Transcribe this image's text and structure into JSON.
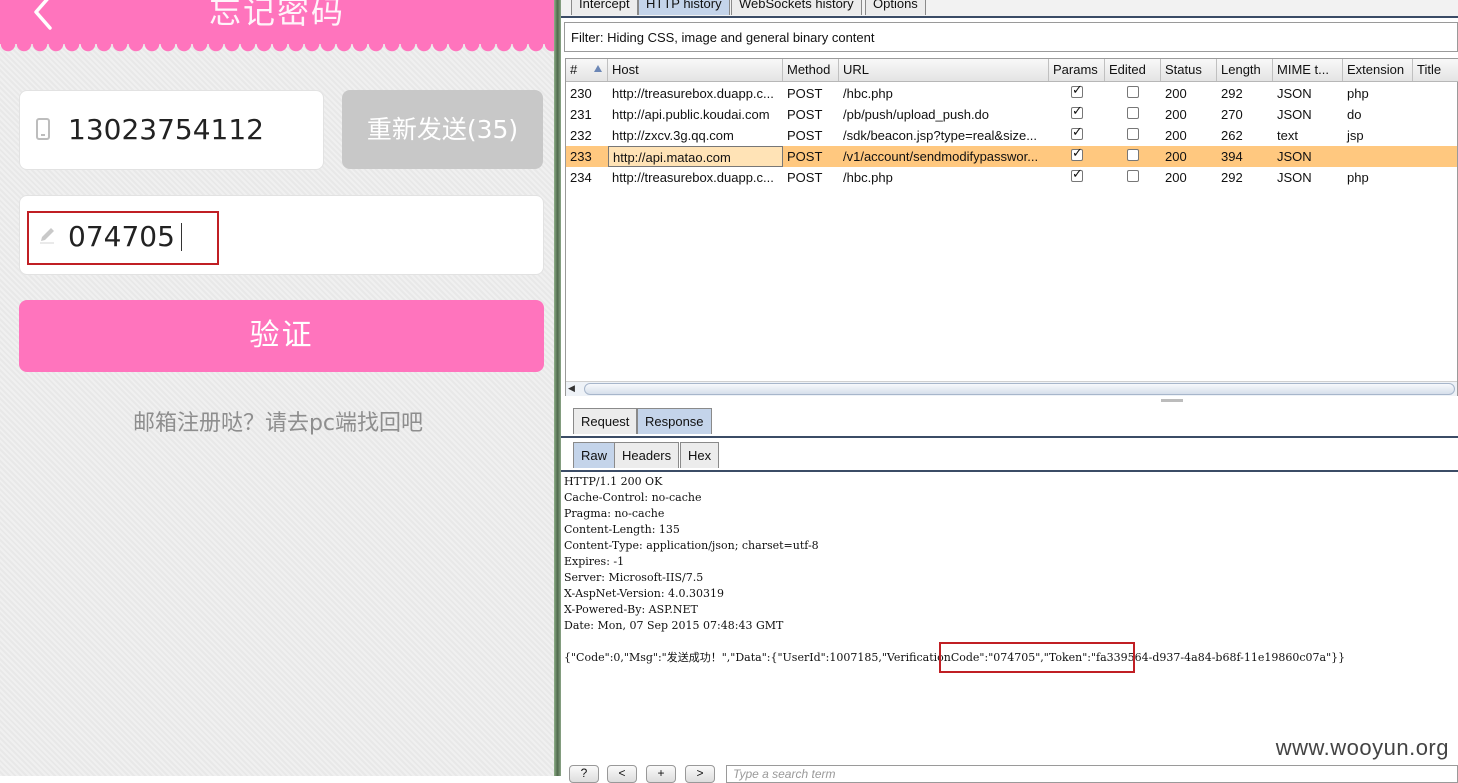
{
  "app": {
    "title": "忘记密码",
    "phone_number": "13023754112",
    "resend_label": "重新发送(35)",
    "code_value": "074705",
    "verify_label": "验证",
    "hint": "邮箱注册哒？请去pc端找回吧",
    "accent": "#ff74bd"
  },
  "burp": {
    "tabs": [
      "Intercept",
      "HTTP history",
      "WebSockets history",
      "Options"
    ],
    "active_tab": "HTTP history",
    "filter": "Filter: Hiding CSS, image and general binary content",
    "columns": [
      "#",
      "Host",
      "Method",
      "URL",
      "Params",
      "Edited",
      "Status",
      "Length",
      "MIME t...",
      "Extension",
      "Title"
    ],
    "rows": [
      {
        "num": "230",
        "host": "http://treasurebox.duapp.c...",
        "method": "POST",
        "url": "/hbc.php",
        "params": true,
        "edited": false,
        "status": "200",
        "length": "292",
        "mime": "JSON",
        "ext": "php",
        "selected": false
      },
      {
        "num": "231",
        "host": "http://api.public.koudai.com",
        "method": "POST",
        "url": "/pb/push/upload_push.do",
        "params": true,
        "edited": false,
        "status": "200",
        "length": "270",
        "mime": "JSON",
        "ext": "do",
        "selected": false
      },
      {
        "num": "232",
        "host": "http://zxcv.3g.qq.com",
        "method": "POST",
        "url": "/sdk/beacon.jsp?type=real&size...",
        "params": true,
        "edited": false,
        "status": "200",
        "length": "262",
        "mime": "text",
        "ext": "jsp",
        "selected": false
      },
      {
        "num": "233",
        "host": "http://api.matao.com",
        "method": "POST",
        "url": "/v1/account/sendmodifypasswor...",
        "params": true,
        "edited": false,
        "status": "200",
        "length": "394",
        "mime": "JSON",
        "ext": "",
        "selected": true
      },
      {
        "num": "234",
        "host": "http://treasurebox.duapp.c...",
        "method": "POST",
        "url": "/hbc.php",
        "params": true,
        "edited": false,
        "status": "200",
        "length": "292",
        "mime": "JSON",
        "ext": "php",
        "selected": false
      }
    ],
    "req_tabs": [
      "Request",
      "Response"
    ],
    "active_req_tab": "Response",
    "view_tabs": [
      "Raw",
      "Headers",
      "Hex"
    ],
    "active_view_tab": "Raw",
    "response_headers": [
      "HTTP/1.1 200 OK",
      "Cache-Control: no-cache",
      "Pragma: no-cache",
      "Content-Length: 135",
      "Content-Type: application/json; charset=utf-8",
      "Expires: -1",
      "Server: Microsoft-IIS/7.5",
      "X-AspNet-Version: 4.0.30319",
      "X-Powered-By: ASP.NET",
      "Date: Mon, 07 Sep 2015 07:48:43 GMT"
    ],
    "response_body": "{\"Code\":0,\"Msg\":\"发送成功！\",\"Data\":{\"UserId\":1007185,\"VerificationCode\":\"074705\",\"Token\":\"fa339564-d937-4a84-b68f-11e19860c07a\"}}",
    "nav_buttons": [
      "?",
      "<",
      "+",
      ">"
    ],
    "search_placeholder": "Type a search term"
  },
  "watermark": "www.wooyun.org"
}
